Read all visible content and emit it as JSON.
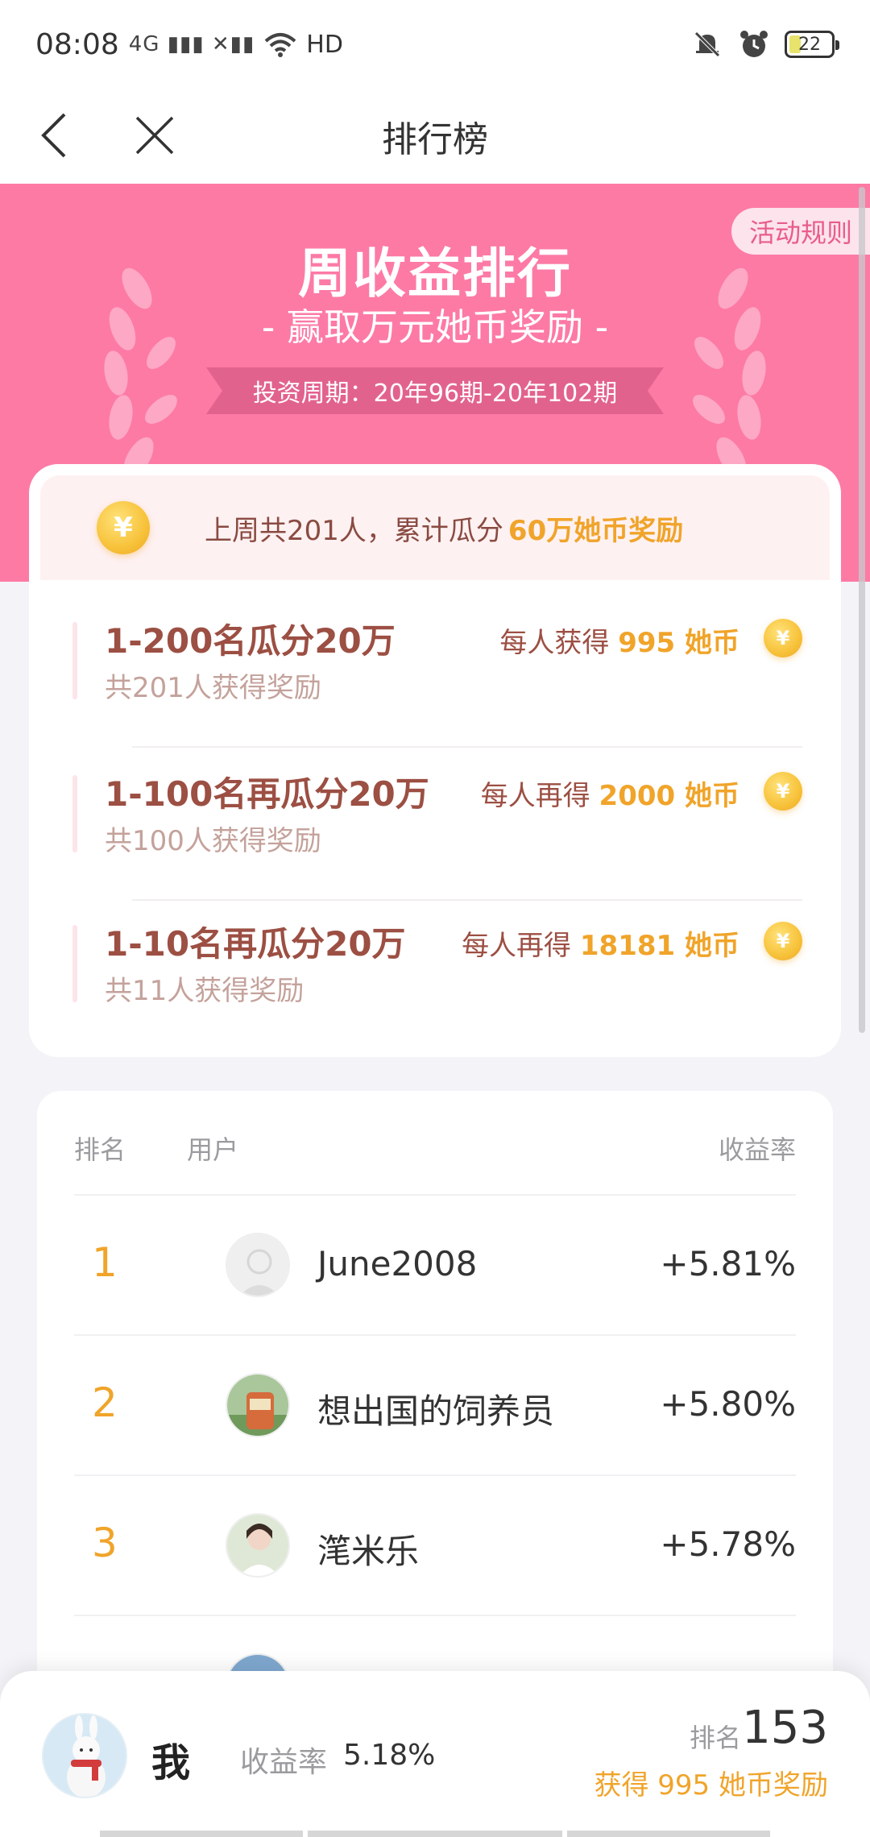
{
  "status_bar": {
    "time": "08:08",
    "signal": "4G ▮▮▮ ✕▮▮",
    "hd": "HD",
    "battery": "22"
  },
  "nav": {
    "title": "排行榜"
  },
  "banner": {
    "rules_label": "活动规则",
    "title": "周收益排行",
    "subtitle": "- 赢取万元她币奖励 -",
    "period": "投资周期：20年96期-20年102期"
  },
  "reward": {
    "summary_prefix": "上周共201人，累计瓜分",
    "summary_highlight": "60万她币奖励",
    "coin_glyph": "¥",
    "tiers": [
      {
        "name": "1-200名瓜分20万",
        "count": "共201人获得奖励",
        "amount_prefix": "每人获得",
        "amount_value": "995 她币"
      },
      {
        "name": "1-100名再瓜分20万",
        "count": "共100人获得奖励",
        "amount_prefix": "每人再得",
        "amount_value": "2000 她币"
      },
      {
        "name": "1-10名再瓜分20万",
        "count": "共11人获得奖励",
        "amount_prefix": "每人再得",
        "amount_value": "18181 她币"
      }
    ]
  },
  "ranking": {
    "columns": {
      "rank": "排名",
      "user": "用户",
      "rate": "收益率"
    },
    "rows": [
      {
        "rank": "1",
        "user": "June2008",
        "rate": "+5.81%"
      },
      {
        "rank": "2",
        "user": "想出国的饲养员",
        "rate": "+5.80%"
      },
      {
        "rank": "3",
        "user": "滗米乐",
        "rate": "+5.78%"
      }
    ]
  },
  "me": {
    "name": "我",
    "rate_label": "收益率",
    "rate": "5.18%",
    "rank_label": "排名",
    "rank": "153",
    "reward": "获得 995 她币奖励"
  },
  "colors": {
    "banner": "#fd7aa5",
    "gold": "#f0a42a",
    "tier_text": "#9c4f43"
  }
}
